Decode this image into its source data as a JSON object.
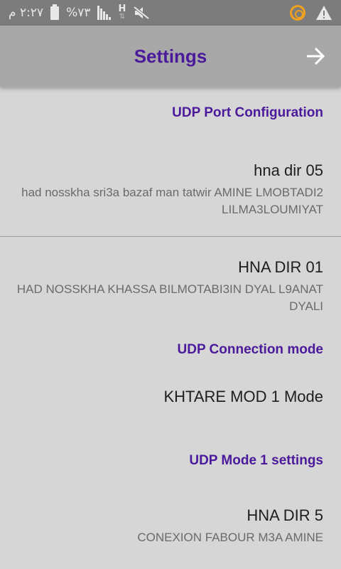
{
  "status_bar": {
    "time": "٢:٢٧ م",
    "battery": "%٧٣",
    "network": "H"
  },
  "app_bar": {
    "title": "Settings"
  },
  "sections": [
    {
      "category": "UDP Port Configuration"
    },
    {
      "title": "hna dir 05",
      "summary": "had nosskha sri3a bazaf man tatwir AMINE LMOBTADI2 LILMA3LOUMIYAT"
    },
    {
      "title": "HNA DIR 01",
      "summary": "HAD NOSSKHA KHASSA BILMOTABI3IN DYAL L9ANAT DYALI"
    },
    {
      "category": "UDP Connection mode"
    },
    {
      "title": "KHTARE MOD 1 Mode"
    },
    {
      "category": "UDP Mode 1 settings"
    },
    {
      "title": "HNA DIR 5",
      "summary": "CONEXION FABOUR M3A AMINE"
    }
  ],
  "colors": {
    "accent": "#4b1a9b",
    "status_bar": "#7c7c7c",
    "app_bar": "#a8a8a8",
    "background": "#d6d6d6"
  },
  "icons": {
    "back": "arrow-right-icon",
    "battery": "battery-icon",
    "signal": "signal-icon",
    "mute": "mute-icon",
    "notification": "notification-icon",
    "warning": "warning-icon"
  }
}
